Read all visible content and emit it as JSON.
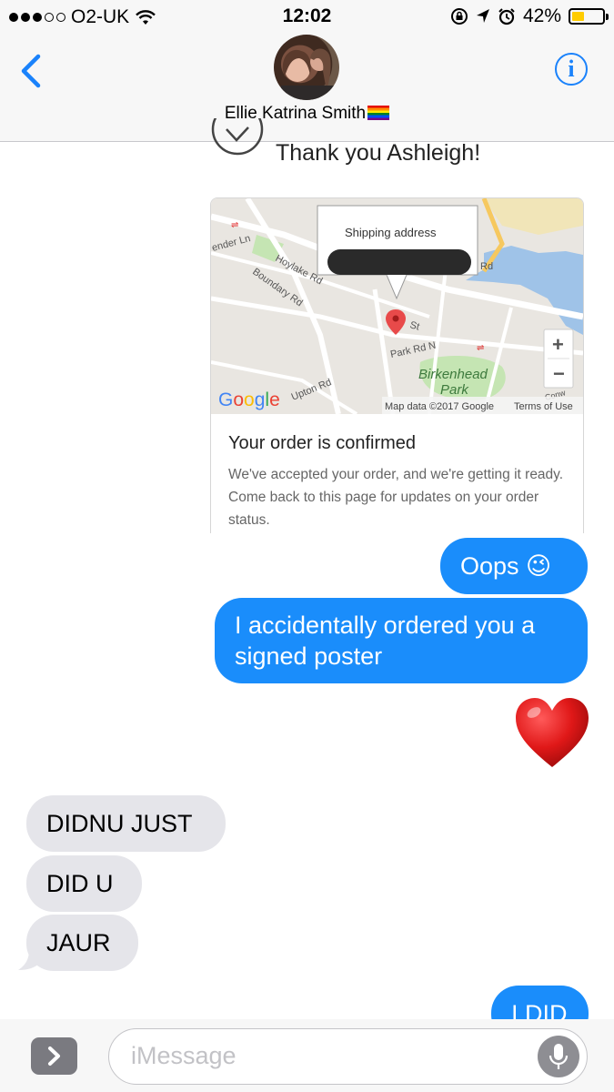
{
  "status_bar": {
    "carrier": "O2-UK",
    "time": "12:02",
    "battery_percent": "42%",
    "battery_level": 0.42,
    "icons": [
      "signal-dots-icon",
      "wifi-icon",
      "rotation-lock-icon",
      "location-icon",
      "alarm-icon",
      "battery-icon"
    ]
  },
  "header": {
    "contact_name": "Ellie Katrina Smith",
    "contact_emoji": "rainbow-flag-icon",
    "back_icon": "chevron-left-icon",
    "info_label": "i"
  },
  "thanks": {
    "text": "Thank you Ashleigh!"
  },
  "order_card": {
    "map": {
      "popup_title": "Shipping address",
      "labels": [
        "ender Ln",
        "Hoylake Rd",
        "Boundary Rd",
        "Park Rd N",
        "Birkenhead",
        "Park",
        "Upton Rd",
        "St",
        "Rd",
        "Conw"
      ],
      "attribution": "Map data ©2017 Google",
      "terms": "Terms of Use",
      "logo": "Google",
      "zoom_in": "+",
      "zoom_out": "−"
    },
    "title": "Your order is confirmed",
    "body": "We've accepted your order, and we're getting it ready. Come back to this page for updates on your order status."
  },
  "messages": [
    {
      "direction": "outgoing",
      "text": "Oops 😉"
    },
    {
      "direction": "outgoing",
      "text": "I accidentally ordered you a signed poster"
    },
    {
      "direction": "outgoing",
      "text": "❤️"
    },
    {
      "direction": "incoming",
      "text": "DIDNU JUST"
    },
    {
      "direction": "incoming",
      "text": "DID U"
    },
    {
      "direction": "incoming",
      "text": "JAUR"
    },
    {
      "direction": "outgoing",
      "text": "I DID"
    }
  ],
  "input": {
    "placeholder": "iMessage",
    "expand_icon": "chevron-right-icon",
    "mic_icon": "microphone-icon"
  },
  "colors": {
    "outgoing_bubble": "#1a8dfb",
    "incoming_bubble": "#e5e5ea",
    "accent": "#1a82fb",
    "battery_fill": "#ffcc00"
  }
}
